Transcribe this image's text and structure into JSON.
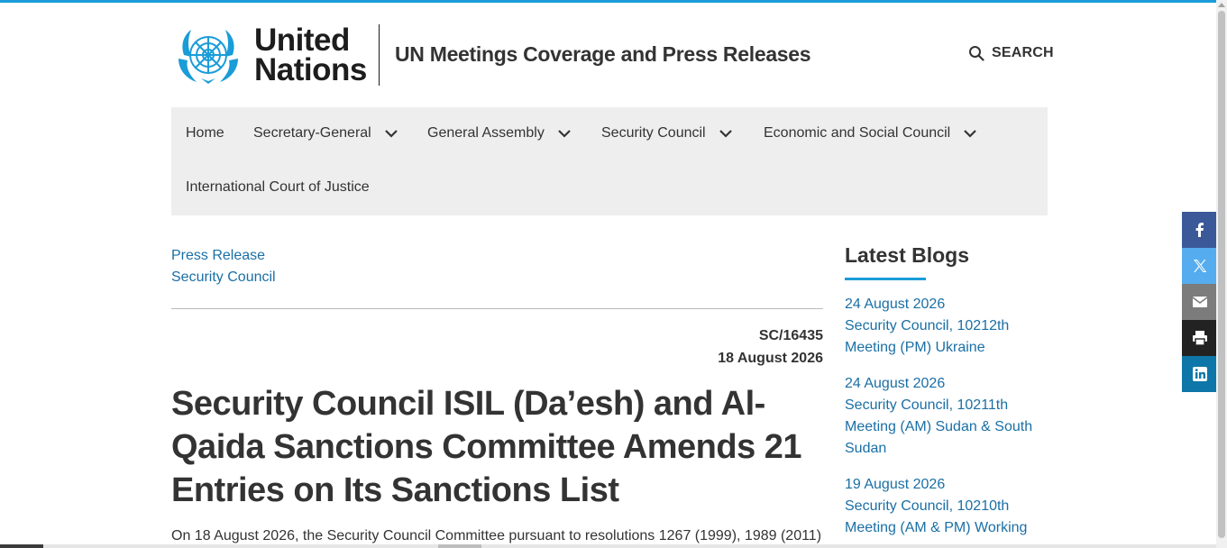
{
  "header": {
    "logo": {
      "line1": "United",
      "line2": "Nations"
    },
    "site_title": "UN Meetings Coverage and Press Releases",
    "search_label": "SEARCH"
  },
  "nav": {
    "items": [
      {
        "label": "Home",
        "has_dropdown": false
      },
      {
        "label": "Secretary-General",
        "has_dropdown": true
      },
      {
        "label": "General Assembly",
        "has_dropdown": true
      },
      {
        "label": "Security Council",
        "has_dropdown": true
      },
      {
        "label": "Economic and Social Council",
        "has_dropdown": true
      },
      {
        "label": "International Court of Justice",
        "has_dropdown": false
      }
    ]
  },
  "breadcrumbs": [
    "Press Release",
    "Security Council"
  ],
  "document": {
    "code": "SC/16435",
    "date": "18 August 2026",
    "title": "Security Council ISIL (Da’esh) and Al-Qaida Sanctions Committee Amends 21 Entries on Its Sanctions List",
    "lead": "On 18 August 2026, the Security Council Committee pursuant to resolutions 1267 (1999), 1989 (2011)"
  },
  "sidebar": {
    "title": "Latest Blogs",
    "blogs": [
      {
        "date": "24 August 2026",
        "title": "Security Council, 10212th Meeting (PM) Ukraine"
      },
      {
        "date": "24 August 2026",
        "title": "Security Council, 10211th Meeting (AM) Sudan & South Sudan"
      },
      {
        "date": "19 August 2026",
        "title": "Security Council, 10210th Meeting (AM & PM) Working"
      }
    ]
  },
  "share": [
    {
      "name": "facebook-icon",
      "color": "#3b5998"
    },
    {
      "name": "x-icon",
      "color": "#55acee"
    },
    {
      "name": "email-icon",
      "color": "#7c7c7c"
    },
    {
      "name": "print-icon",
      "color": "#222222"
    },
    {
      "name": "linkedin-icon",
      "color": "#0e76a8"
    }
  ],
  "colors": {
    "accent": "#1a9cd8",
    "link": "#1a6fa5",
    "nav_bg": "#eeeeee",
    "text": "#333333"
  }
}
